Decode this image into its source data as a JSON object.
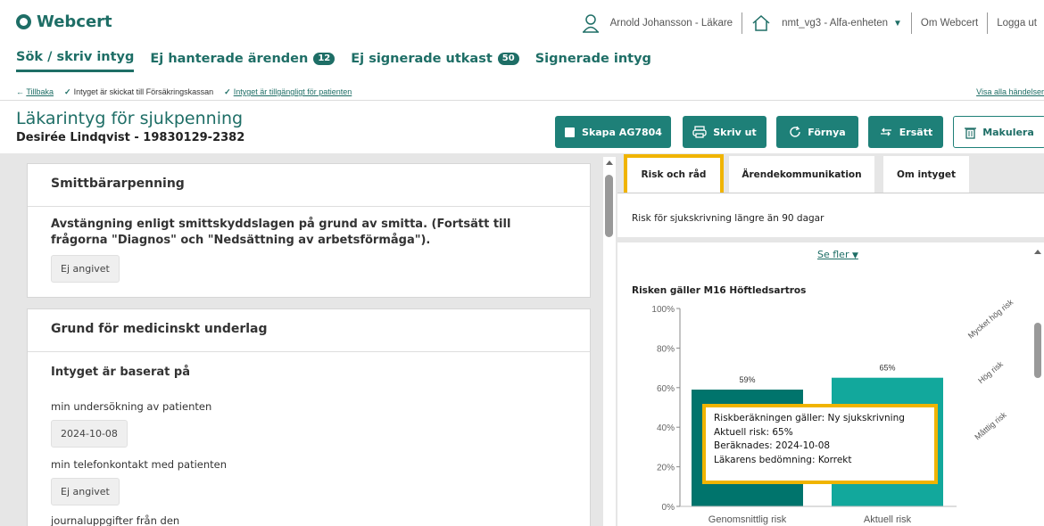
{
  "header": {
    "app_name": "Webcert",
    "user": "Arnold Johansson - Läkare",
    "unit": "nmt_vg3 - Alfa-enheten",
    "about": "Om Webcert",
    "logout": "Logga ut"
  },
  "nav": {
    "tabs": [
      {
        "label": "Sök / skriv intyg",
        "active": true
      },
      {
        "label": "Ej hanterade ärenden",
        "badge": "12"
      },
      {
        "label": "Ej signerade utkast",
        "badge": "50"
      },
      {
        "label": "Signerade intyg"
      }
    ]
  },
  "crumbs": {
    "back": "Tillbaka",
    "sent": "Intyget är skickat till Försäkringskassan",
    "available": "Intyget är tillgängligt för patienten",
    "show_all": "Visa alla händelser"
  },
  "certificate": {
    "title": "Läkarintyg för sjukpenning",
    "patient": "Desirée Lindqvist - 19830129-2382"
  },
  "actions": {
    "create": "Skapa AG7804",
    "print": "Skriv ut",
    "renew": "Förnya",
    "replace": "Ersätt",
    "revoke": "Makulera"
  },
  "sections": {
    "smitt": {
      "heading": "Smittbärarpenning",
      "question": "Avstängning enligt smittskyddslagen på grund av smitta. (Fortsätt till frågorna \"Diagnos\" och \"Nedsättning av arbetsförmåga\").",
      "answer": "Ej angivet"
    },
    "grund": {
      "heading": "Grund för medicinskt underlag",
      "question": "Intyget är baserat på",
      "exam_label": "min undersökning av patienten",
      "exam_value": "2024-10-08",
      "phone_label": "min telefonkontakt med patienten",
      "phone_value": "Ej angivet",
      "journal_label": "journaluppgifter från den"
    }
  },
  "right_tabs": {
    "risk": "Risk och råd",
    "comm": "Ärendekommunikation",
    "about": "Om intyget"
  },
  "risk": {
    "heading": "Risk för sjukskrivning längre än 90 dagar",
    "see_more": "Se fler",
    "applies_to": "Risken gäller M16 Höftledsartros",
    "tooltip": {
      "line1": "Riskberäkningen gäller: Ny sjukskrivning",
      "line2": "Aktuell risk: 65%",
      "line3": "Beräknades: 2024-10-08",
      "line4": "Läkarens bedömning: Korrekt"
    }
  },
  "colors": {
    "brand": "#1e6e66",
    "button": "#1e8078",
    "bar_avg": "#00746c",
    "bar_current": "#12a89c",
    "highlight": "#f0b400"
  },
  "chart_data": {
    "type": "bar",
    "categories": [
      "Genomsnittlig risk",
      "Aktuell risk"
    ],
    "values": [
      59,
      65
    ],
    "value_labels": [
      "59%",
      "65%"
    ],
    "ylim": [
      0,
      100
    ],
    "y_ticks": [
      "0%",
      "20%",
      "40%",
      "60%",
      "80%",
      "100%"
    ],
    "band_labels": [
      "Måttlig risk",
      "Hög risk",
      "Mycket hög risk"
    ],
    "grid": false
  }
}
